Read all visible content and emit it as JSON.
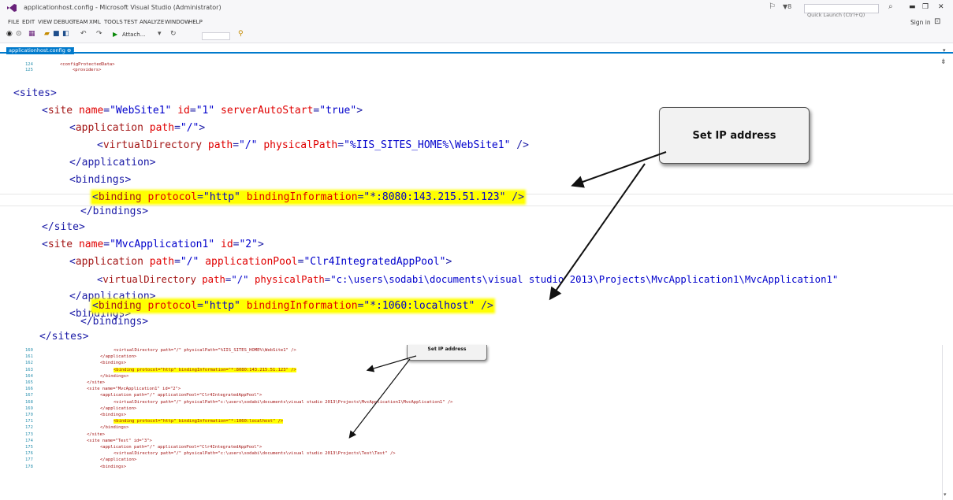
{
  "window": {
    "title": "applicationhost.config - Microsoft Visual Studio (Administrator)",
    "quick_launch_placeholder": "Quick Launch (Ctrl+Q)",
    "sign_in": "Sign in"
  },
  "menu": [
    "FILE",
    "EDIT",
    "VIEW",
    "DEBUG",
    "TEAM",
    "XML",
    "TOOLS",
    "TEST",
    "ANALYZE",
    "WINDOW",
    "HELP"
  ],
  "toolbar": {
    "attach_label": "Attach..."
  },
  "document_tab": {
    "label": "applicationhost.config",
    "pin": "⊕",
    "close": "✕"
  },
  "top_lines": [
    {
      "num": "124",
      "code": "<configProtectedData>"
    },
    {
      "num": "125",
      "code": "<providers>"
    }
  ],
  "callout": {
    "text": "Set IP address",
    "small_text": "Set IP address"
  },
  "zoom": {
    "l1": "<sites>",
    "l2_tag": "site",
    "l2_a1": "name",
    "l2_v1": "\"WebSite1\"",
    "l2_a2": "id",
    "l2_v2": "\"1\"",
    "l2_a3": "serverAutoStart",
    "l2_v3": "\"true\"",
    "l3_tag": "application",
    "l3_a1": "path",
    "l3_v1": "\"/\"",
    "l4_tag": "virtualDirectory",
    "l4_a1": "path",
    "l4_v1": "\"/\"",
    "l4_a2": "physicalPath",
    "l4_v2": "\"%IIS_SITES_HOME%\\WebSite1\"",
    "l5": "</application>",
    "l6": "<bindings>",
    "l7_tag": "binding",
    "l7_a1": "protocol",
    "l7_v1": "\"http\"",
    "l7_a2": "bindingInformation",
    "l7_v2": "\"*:8080:143.215.51.123\"",
    "l8": "</bindings>",
    "l9": "</site>",
    "l10_tag": "site",
    "l10_a1": "name",
    "l10_v1": "\"MvcApplication1\"",
    "l10_a2": "id",
    "l10_v2": "\"2\"",
    "l11_tag": "application",
    "l11_a1": "path",
    "l11_v1": "\"/\"",
    "l11_a2": "applicationPool",
    "l11_v2": "\"Clr4IntegratedAppPool\"",
    "l12_tag": "virtualDirectory",
    "l12_a1": "path",
    "l12_v1": "\"/\"",
    "l12_a2": "physicalPath",
    "l12_v2": "\"c:\\users\\sodabi\\documents\\visual studio 2013\\Projects\\MvcApplication1\\MvcApplication1\"",
    "l13": "</application>",
    "l14": "<bindings>",
    "l15_tag": "binding",
    "l15_a1": "protocol",
    "l15_v1": "\"http\"",
    "l15_a2": "bindingInformation",
    "l15_v2": "\"*:1060:localhost\"",
    "l16": "</bindings>",
    "l17": "</sites>"
  },
  "small_lines": [
    {
      "num": "160",
      "code": "<virtualDirectory path=\"/\" physicalPath=\"%IIS_SITES_HOME%\\WebSite1\" />",
      "indent": 3
    },
    {
      "num": "161",
      "code": "</application>",
      "indent": 2
    },
    {
      "num": "162",
      "code": "<bindings>",
      "indent": 2
    },
    {
      "num": "163",
      "code": "<binding protocol=\"http\" bindingInformation=\"*:8080:143.215.51.123\" />",
      "indent": 3
    },
    {
      "num": "164",
      "code": "</bindings>",
      "indent": 2
    },
    {
      "num": "165",
      "code": "</site>",
      "indent": 1
    },
    {
      "num": "166",
      "code": "<site name=\"MvcApplication1\" id=\"2\">",
      "indent": 1
    },
    {
      "num": "167",
      "code": "<application path=\"/\" applicationPool=\"Clr4IntegratedAppPool\">",
      "indent": 2
    },
    {
      "num": "168",
      "code": "<virtualDirectory path=\"/\" physicalPath=\"c:\\users\\sodabi\\documents\\visual studio 2013\\Projects\\MvcApplication1\\MvcApplication1\" />",
      "indent": 3
    },
    {
      "num": "169",
      "code": "</application>",
      "indent": 2
    },
    {
      "num": "170",
      "code": "<bindings>",
      "indent": 2
    },
    {
      "num": "171",
      "code": "<binding protocol=\"http\" bindingInformation=\"*:1060:localhost\" />",
      "indent": 3
    },
    {
      "num": "172",
      "code": "</bindings>",
      "indent": 2
    },
    {
      "num": "173",
      "code": "</site>",
      "indent": 1
    },
    {
      "num": "174",
      "code": "<site name=\"Test\" id=\"3\">",
      "indent": 1
    },
    {
      "num": "175",
      "code": "<application path=\"/\" applicationPool=\"Clr4IntegratedAppPool\">",
      "indent": 2
    },
    {
      "num": "176",
      "code": "<virtualDirectory path=\"/\" physicalPath=\"c:\\users\\sodabi\\documents\\visual studio 2013\\Projects\\Test\\Test\" />",
      "indent": 3
    },
    {
      "num": "177",
      "code": "</application>",
      "indent": 2
    },
    {
      "num": "178",
      "code": "<bindings>",
      "indent": 2
    }
  ],
  "colors": {
    "accent": "#007acc",
    "highlight": "#ffff00",
    "tag": "#1a1aa6",
    "element": "#a31515",
    "attribute": "#e00000",
    "value": "#0000cc"
  }
}
